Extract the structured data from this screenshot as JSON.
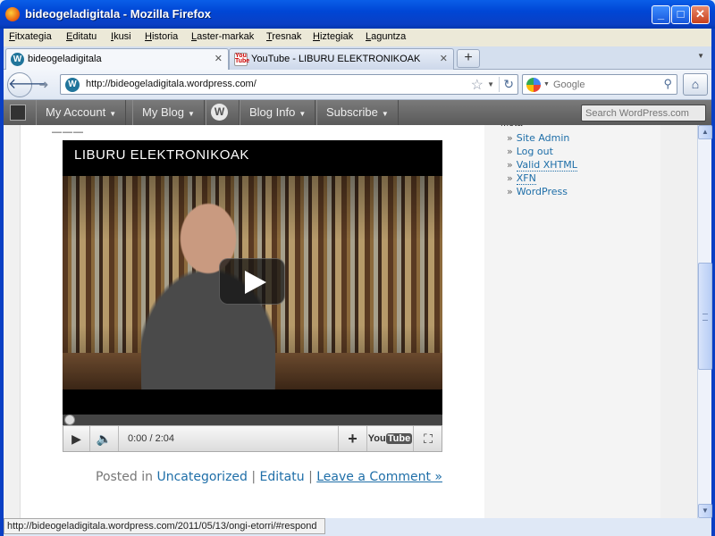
{
  "window": {
    "title": "bideogeladigitala - Mozilla Firefox",
    "minimize": "_",
    "maximize": "□",
    "close": "✕"
  },
  "menu": [
    "Fitxategia",
    "Editatu",
    "Ikusi",
    "Historia",
    "Laster-markak",
    "Tresnak",
    "Hiztegiak",
    "Laguntza"
  ],
  "tabs": [
    {
      "label": "bideogeladigitala",
      "icon": "wordpress-icon",
      "active": true
    },
    {
      "label": "YouTube - LIBURU ELEKTRONIKOAK",
      "icon": "youtube-icon",
      "active": false
    }
  ],
  "navbar": {
    "url": "http://bideogeladigitala.wordpress.com/",
    "search_placeholder": "Google"
  },
  "wp_admin_bar": {
    "my_account": "My Account",
    "my_blog": "My Blog",
    "blog_info": "Blog Info",
    "subscribe": "Subscribe",
    "search_placeholder": "Search WordPress.com"
  },
  "sidebar": {
    "meta_links": [
      "Site Admin",
      "Log out",
      "Valid XHTML",
      "XFN",
      "WordPress"
    ]
  },
  "video": {
    "title": "LIBURU ELEKTRONIKOAK",
    "time": "0:00 / 2:04",
    "brand": "You",
    "brand_tube": "Tube",
    "progress": 0
  },
  "post": {
    "posted_in": "Posted in",
    "category": "Uncategorized",
    "edit": "Editatu",
    "comment": "Leave a Comment »",
    "sep": "|"
  },
  "status": {
    "text": "http://bideogeladigitala.wordpress.com/2011/05/13/ongi-etorri/#respond"
  },
  "colors": {
    "titlebar": "#0046d5",
    "link": "#1e6ea8",
    "wp_bar": "#5a5a5a"
  }
}
